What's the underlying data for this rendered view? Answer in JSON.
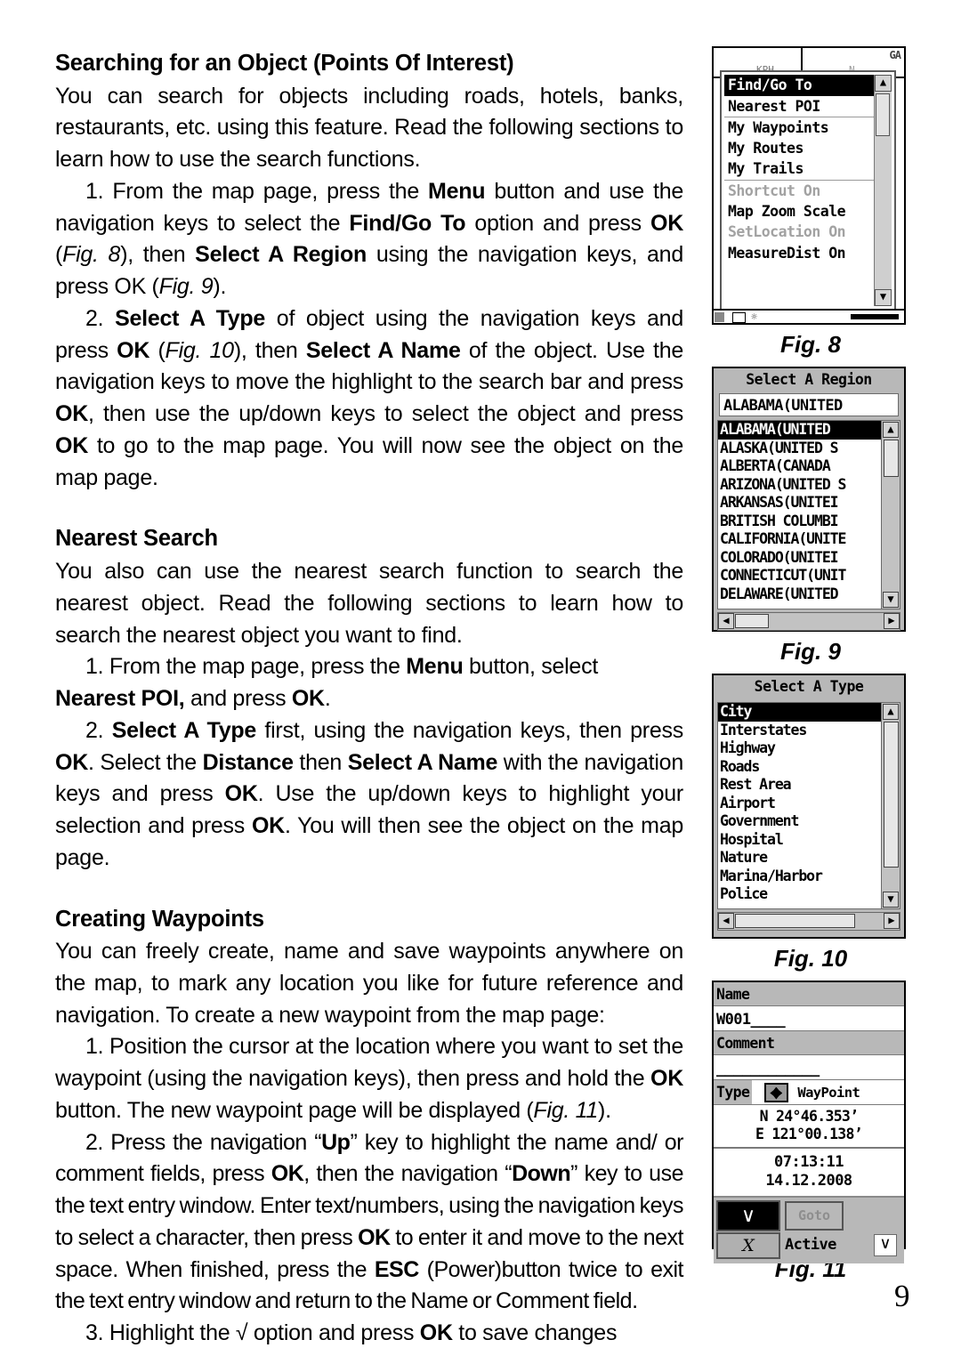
{
  "page": {
    "number": "9"
  },
  "content": {
    "section1": {
      "heading_bold": "Searching for an Object",
      "heading_rest": " (Points Of Interest)",
      "intro": "You can search for objects including roads, hotels, banks, restaurants, etc. using this feature. Read the following sections to learn how to use the search functions.",
      "step1": "1. From the map page, press the <b>Menu</b> button and use the navigation keys to select the <b>Find/Go To</b> option and press <b>OK</b> (<i>Fig. 8</i>), then <b>Select A Region</b> using the navigation keys, and press OK (<i>Fig. 9</i>).",
      "step2": "2. <b>Select A Type</b> of object using the navigation keys and press <b>OK</b> (<i>Fig. 10</i>), then <b>Select A Name</b> of the object. Use the navigation keys to move the highlight to the search bar and press <b>OK</b>, then use the up/down keys to select the object and press <b>OK</b> to go to the map page. You will now see the object on the map page."
    },
    "section2": {
      "heading": "Nearest Search",
      "intro": "You also can use the nearest search function to search the nearest object. Read the following sections to learn how to search the nearest object you want to find.",
      "step1": "1. From the map page, press the <b>Menu</b> button, select <b>Nearest POI,</b> and press <b>OK</b>.",
      "step2": "2. <b>Select A Type</b> first, using the navigation keys, then press <b>OK</b>. Select the <b>Distance</b> then <b>Select A Name</b> with the navigation keys and press <b>OK</b>. Use the up/down keys to highlight your selection and press <b>OK</b>. You will then see the object on the map page."
    },
    "section3": {
      "heading": "Creating Waypoints",
      "intro": "You can freely create, name and save waypoints anywhere on the map, to mark any location you like for future reference and navigation. To create a new waypoint from the map page:",
      "step1": "1. Position the cursor at the location where you want to set the waypoint (using the navigation keys), then press and hold the <b>OK</b> button. The new waypoint page will be displayed (<i>Fig. 11</i>).",
      "step2": "2. Press the navigation “<b>Up</b>” key to highlight the name and/ or comment fields, press <b>OK</b>, then the navigation “<b>Down</b>” key to use the text entry window. Enter text/numbers, using the navigation keys to select a character, then press <b>OK</b> to enter it and move to the next space. When finished, press the <b>ESC</b> (Power)button twice to exit the text entry window and return to the Name or Comment field.",
      "step3": "3.  Highlight the √ option and press <b>OK</b> to save changes"
    }
  },
  "figures": {
    "fig8": {
      "caption": "Fig. 8",
      "status_bar": {
        "right_label": "GA",
        "left_label": "KPH",
        "mid_label": "N"
      },
      "menu_items": [
        {
          "label": "Find/Go To",
          "state": "selected",
          "separator_above": false
        },
        {
          "label": "Nearest POI",
          "state": "normal",
          "separator_above": false
        },
        {
          "label": "My Waypoints",
          "state": "normal",
          "separator_above": true
        },
        {
          "label": "My Routes",
          "state": "normal",
          "separator_above": false
        },
        {
          "label": "My Trails",
          "state": "normal",
          "separator_above": false
        },
        {
          "label": "Shortcut On",
          "state": "disabled",
          "separator_above": true
        },
        {
          "label": "Map Zoom Scale",
          "state": "normal",
          "separator_above": false
        },
        {
          "label": "SetLocation On",
          "state": "disabled",
          "separator_above": false
        },
        {
          "label": "MeasureDist On",
          "state": "normal",
          "separator_above": false
        }
      ],
      "scroll_up": "▲",
      "scroll_down": "▼"
    },
    "fig9": {
      "caption": "Fig. 9",
      "title": "Select A Region",
      "search_value": "ALABAMA(UNITED",
      "items": [
        "ALABAMA(UNITED",
        "ALASKA(UNITED S",
        "ALBERTA(CANADA",
        "ARIZONA(UNITED S",
        "ARKANSAS(UNITEI",
        "BRITISH COLUMBI",
        "CALIFORNIA(UNITE",
        "COLORADO(UNITEI",
        "CONNECTICUT(UNIT",
        "DELAWARE(UNITED"
      ],
      "selected_index": 0,
      "scroll_up": "▲",
      "scroll_down": "▼",
      "scroll_left": "◀",
      "scroll_right": "▶"
    },
    "fig10": {
      "caption": "Fig. 10",
      "title": "Select A Type",
      "items": [
        "City",
        "Interstates",
        "Highway",
        "Roads",
        "Rest Area",
        "Airport",
        "Government",
        "Hospital",
        "Nature",
        "Marina/Harbor",
        "Police"
      ],
      "selected_index": 0,
      "scroll_up": "▲",
      "scroll_down": "▼",
      "scroll_left": "◀",
      "scroll_right": "▶"
    },
    "fig11": {
      "caption": "Fig. 11",
      "name_label": "Name",
      "name_value": "W001____",
      "comment_label": "Comment",
      "comment_value": "____________",
      "type_label": "Type",
      "type_value": "WayPoint",
      "type_icon": "waypoint-diamond-icon",
      "latitude": "N 24°46.353’",
      "longitude": "E 121°00.138’",
      "time": "07:13:11",
      "date": "14.12.2008",
      "ok_label": "∨",
      "cancel_label": "X",
      "goto_label": "Goto",
      "active_label": "Active",
      "active_checked": "∨"
    }
  }
}
